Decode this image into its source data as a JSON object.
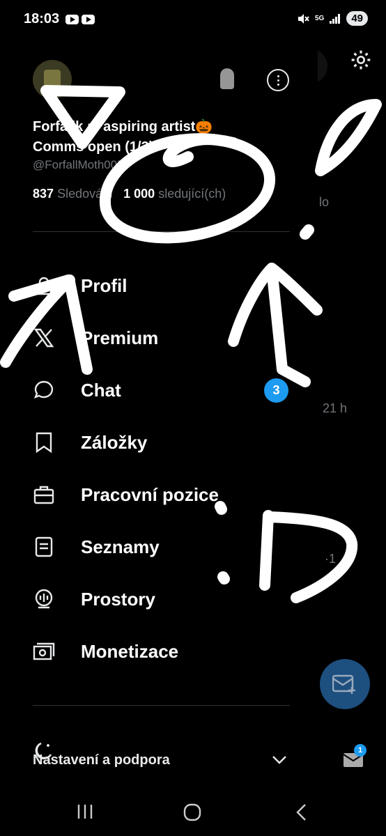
{
  "status_bar": {
    "time": "18:03",
    "network": "5G",
    "battery": "49"
  },
  "profile": {
    "display_name_line1": "Forfallk :3 aspiring artist🎃",
    "display_name_line2": "Comms open (1/3)",
    "handle": "@ForfallMoth005",
    "following_count": "837",
    "following_label": "Sledování",
    "followers_count": "1 000",
    "followers_label": "sledující(ch)"
  },
  "menu": {
    "items": [
      {
        "label": "Profil",
        "icon": "person-icon"
      },
      {
        "label": "Premium",
        "icon": "x-logo-icon"
      },
      {
        "label": "Chat",
        "icon": "chat-bubble-icon",
        "badge": "3"
      },
      {
        "label": "Záložky",
        "icon": "bookmark-icon"
      },
      {
        "label": "Pracovní pozice",
        "icon": "briefcase-icon"
      },
      {
        "label": "Seznamy",
        "icon": "list-icon"
      },
      {
        "label": "Prostory",
        "icon": "mic-icon"
      },
      {
        "label": "Monetizace",
        "icon": "money-icon"
      }
    ]
  },
  "settings_support": "Nastavení a podpora",
  "background": {
    "text_lo": "lo",
    "text_time": "21 h",
    "text_one": "·1",
    "mail_badge": "1"
  },
  "colors": {
    "accent": "#1d9bf0",
    "background": "#000000",
    "text": "#e7e9ea",
    "muted": "#71767b"
  }
}
